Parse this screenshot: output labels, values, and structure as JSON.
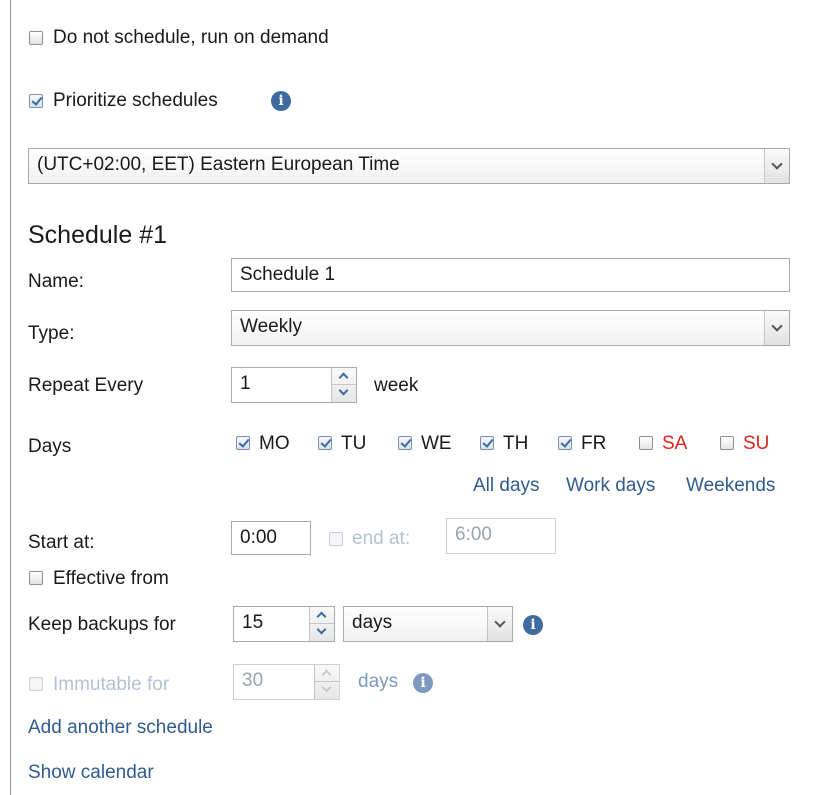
{
  "top_options": {
    "run_on_demand": {
      "label": "Do not schedule, run on demand",
      "checked": false
    },
    "prioritize": {
      "label": "Prioritize schedules",
      "checked": true
    }
  },
  "timezone": {
    "value": "(UTC+02:00, EET) Eastern European Time"
  },
  "schedule": {
    "heading": "Schedule #1",
    "name_label": "Name:",
    "name_value": "Schedule 1",
    "type_label": "Type:",
    "type_value": "Weekly",
    "repeat_label": "Repeat Every",
    "repeat_value": "1",
    "repeat_unit": "week",
    "days_label": "Days",
    "days": [
      {
        "label": "MO",
        "checked": true,
        "color": "#1a1a1a"
      },
      {
        "label": "TU",
        "checked": true,
        "color": "#1a1a1a"
      },
      {
        "label": "WE",
        "checked": true,
        "color": "#1a1a1a"
      },
      {
        "label": "TH",
        "checked": true,
        "color": "#1a1a1a"
      },
      {
        "label": "FR",
        "checked": true,
        "color": "#1a1a1a"
      },
      {
        "label": "SA",
        "checked": false,
        "color": "#e0241b"
      },
      {
        "label": "SU",
        "checked": false,
        "color": "#e0241b"
      }
    ],
    "day_links": {
      "all": "All days",
      "work": "Work days",
      "weekends": "Weekends"
    },
    "start_label": "Start at:",
    "start_value": "0:00",
    "end_label": "end at:",
    "end_value": "6:00",
    "effective_label": "Effective from",
    "keep_label": "Keep backups for",
    "keep_value": "15",
    "keep_unit": "days",
    "immutable_label": "Immutable for",
    "immutable_value": "30",
    "immutable_unit": "days"
  },
  "links": {
    "add_schedule": "Add another schedule",
    "show_calendar": "Show calendar"
  },
  "colors": {
    "link": "#2f5b8e",
    "weekend": "#e0241b",
    "info_icon": "#3e6aa0"
  }
}
